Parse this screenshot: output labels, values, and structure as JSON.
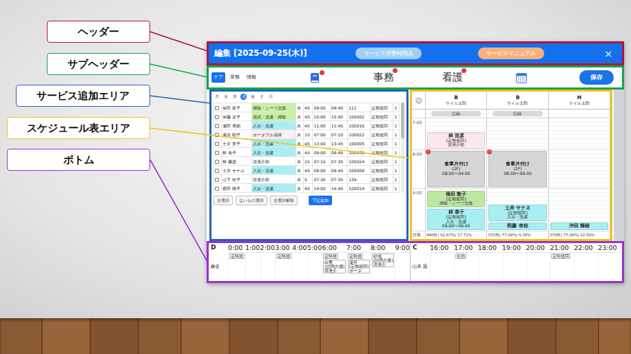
{
  "annotations": [
    {
      "text": "ヘッダー",
      "color": "#b0143c"
    },
    {
      "text": "サブヘッダー",
      "color": "#16a34a"
    },
    {
      "text": "サービス追加エリア",
      "color": "#1f63b8"
    },
    {
      "text": "スケジュール表エリア",
      "color": "#f2c21b"
    },
    {
      "text": "ボトム",
      "color": "#9b2fd6"
    }
  ],
  "header": {
    "title": "編集 [2025-09-25(木)]",
    "buttons": [
      {
        "label": "サービス所要時間表",
        "color": "#9fd0f5"
      },
      {
        "label": "サービスマニュアル",
        "color": "#f7b27c"
      }
    ],
    "close": "×"
  },
  "subheader": {
    "tabs": [
      {
        "label": "ケア",
        "selected": true
      },
      {
        "label": "業務",
        "selected": false
      },
      {
        "label": "情報",
        "selected": false
      }
    ],
    "tools": [
      {
        "kind": "book",
        "badge": true
      },
      {
        "kind": "text",
        "label": "事務",
        "badge": true
      },
      {
        "kind": "text",
        "label": "看護",
        "badge": true
      },
      {
        "kind": "calendar",
        "badge": false
      }
    ],
    "save": "保存"
  },
  "service_add": {
    "days": [
      {
        "label": "月",
        "selected": false
      },
      {
        "label": "火",
        "selected": false
      },
      {
        "label": "水",
        "selected": false
      },
      {
        "label": "木",
        "selected": true
      },
      {
        "label": "金",
        "selected": false
      },
      {
        "label": "土",
        "selected": false
      },
      {
        "label": "日",
        "selected": false
      }
    ],
    "rows": [
      {
        "checked": false,
        "color": "#c6f0a3",
        "cells": [
          "保田 敦子",
          "掃除・シーツ交換",
          "木",
          "40",
          "09:00",
          "09:40",
          "111",
          "定期巡回",
          "1"
        ]
      },
      {
        "checked": false,
        "color": "#c6f0a3",
        "cells": [
          "伊藤 栄子",
          "清拭・洗濯・掃除",
          "木",
          "45",
          "15:00",
          "15:45",
          "100002",
          "定期巡回",
          "1"
        ]
      },
      {
        "checked": false,
        "color": "#a9eef2",
        "cells": [
          "瀬田 孝朗",
          "入浴・洗濯",
          "木",
          "45",
          "11:00",
          "11:45",
          "100016",
          "定期巡回",
          "1"
        ]
      },
      {
        "checked": false,
        "color": "#fdeef2",
        "cells": [
          "廣井 昭子",
          "ポータブル清掃",
          "木",
          "10",
          "07:00",
          "07:10",
          "100022",
          "定期巡回",
          "1"
        ]
      },
      {
        "checked": false,
        "color": "#a9eef2",
        "cells": [
          "土井 美子",
          "入浴・洗濯",
          "木",
          "45",
          "13:00",
          "13:45",
          "100005",
          "定期巡回",
          "1"
        ]
      },
      {
        "checked": false,
        "color": "#a9eef2",
        "cells": [
          "林 恭子",
          "入浴・洗濯",
          "木",
          "45",
          "09:00",
          "09:45",
          "100031",
          "定期巡回",
          "1"
        ]
      },
      {
        "checked": false,
        "color": "#ffffff",
        "cells": [
          "林 蘭彦",
          "排泄介助",
          "木",
          "25",
          "07:10",
          "07:35",
          "100024",
          "定期巡回",
          "1"
        ]
      },
      {
        "checked": false,
        "color": "#a9eef2",
        "cells": [
          "土井 サナヱ",
          "入浴・洗濯",
          "木",
          "45",
          "09:00",
          "09:45",
          "100004",
          "定期巡回",
          "1"
        ]
      },
      {
        "checked": false,
        "color": "#ffffff",
        "cells": [
          "山下 桂子",
          "排泄介助",
          "木",
          "5",
          "07:30",
          "07:35",
          "134",
          "定期巡回",
          "1"
        ]
      },
      {
        "checked": false,
        "color": "#a9eef2",
        "cells": [
          "横田 晴子",
          "入浴・洗濯",
          "木",
          "45",
          "14:00",
          "14:45",
          "100014",
          "定期巡回",
          "1"
        ]
      }
    ],
    "buttons": [
      {
        "label": "全選択",
        "primary": false
      },
      {
        "label": "ないもの選択",
        "primary": false
      },
      {
        "label": "全選択解除",
        "primary": false
      },
      {
        "label": "下記追加",
        "primary": true
      }
    ]
  },
  "schedule": {
    "add": "+",
    "total_label": "計算",
    "columns": [
      {
        "code": "B",
        "staff": "ライル太郎",
        "record": "記録",
        "total": "440分| 91.67%| 17.71%"
      },
      {
        "code": "B",
        "staff": "ライル太郎",
        "record": "記録",
        "total": "370分| 77.08%| 9.38%"
      },
      {
        "code": "H",
        "staff": "ライル太郎",
        "total": "370分| 77.08%| 12.50%"
      }
    ],
    "rows": [
      {
        "time": "7:00",
        "cells": [
          [
            {
              "lines": [
                "林 苗彦",
                "[定期巡回]",
                "排泄介助"
              ],
              "color": "#fde6ee"
            }
          ],
          [],
          []
        ]
      },
      {
        "time": "8:00",
        "cells": [
          [
            {
              "lines": [
                "食事片付け",
                "(2F)",
                "08:00〜09:00"
              ],
              "color": "#d6d6d6",
              "badge": "!"
            }
          ],
          [
            {
              "lines": [
                "食事片付け",
                "(2F)",
                "08:00〜09:00"
              ],
              "color": "#d6d6d6",
              "badge": "!"
            }
          ],
          []
        ]
      },
      {
        "time": "9:00",
        "cells": [
          [
            {
              "lines": [
                "保田 敦子",
                "[定期巡回]",
                "掃除・シーツ交換"
              ],
              "color": "#bde8a4"
            },
            {
              "lines": [
                "林 恭子",
                "[定期巡回]",
                "入浴・洗濯",
                "09:00〜09:45"
              ],
              "color": "#a9eef2"
            }
          ],
          [
            {
              "lines": [
                "土井 サナヱ",
                "[定期巡回]",
                "入浴・洗濯"
              ],
              "color": "#a9eef2"
            },
            {
              "lines": [
                "莉藤 幸枝"
              ],
              "color": "#a9eef2"
            }
          ],
          [
            {
              "lines": [
                "沖田 輝雄"
              ],
              "color": "#a9eef2"
            }
          ]
        ]
      }
    ]
  },
  "bottom": {
    "halves": [
      {
        "label": "D",
        "staff": "貞金",
        "hours": [
          {
            "time": "0:00",
            "chips": [
              [
                "定時巡"
              ]
            ]
          },
          {
            "time": "1:00",
            "chips": []
          },
          {
            "time": "2:00",
            "chips": []
          },
          {
            "time": "3:00",
            "chips": [
              [
                "定時巡"
              ]
            ]
          },
          {
            "time": "4:00",
            "chips": []
          },
          {
            "time": "5:00",
            "chips": []
          },
          {
            "time": "6:00",
            "chips": [
              [
                "定時巡"
              ],
              [
                "白重",
                "[訪問介護]",
                "排泄介"
              ]
            ]
          },
          {
            "time": "7:00",
            "chips": [
              [
                "定時巡"
              ],
              [
                "湯井",
                "[定期巡回]",
                "ポータ"
              ]
            ]
          },
          {
            "time": "8:00",
            "chips": [
              [
                "砂地",
                "[訪問介護]",
                "排泄介"
              ]
            ]
          },
          {
            "time": "9:00",
            "chips": []
          }
        ]
      },
      {
        "label": "C",
        "staff": "山本 延",
        "hours": [
          {
            "time": "16:00",
            "chips": []
          },
          {
            "time": "17:00",
            "chips": [
              [
                "佐伯"
              ]
            ]
          },
          {
            "time": "18:00",
            "chips": []
          },
          {
            "time": "19:00",
            "chips": []
          },
          {
            "time": "20:00",
            "chips": []
          },
          {
            "time": "21:00",
            "chips": [
              [
                "定時巡回"
              ]
            ]
          },
          {
            "time": "22:00",
            "chips": []
          },
          {
            "time": "23:00",
            "chips": []
          }
        ]
      }
    ]
  }
}
